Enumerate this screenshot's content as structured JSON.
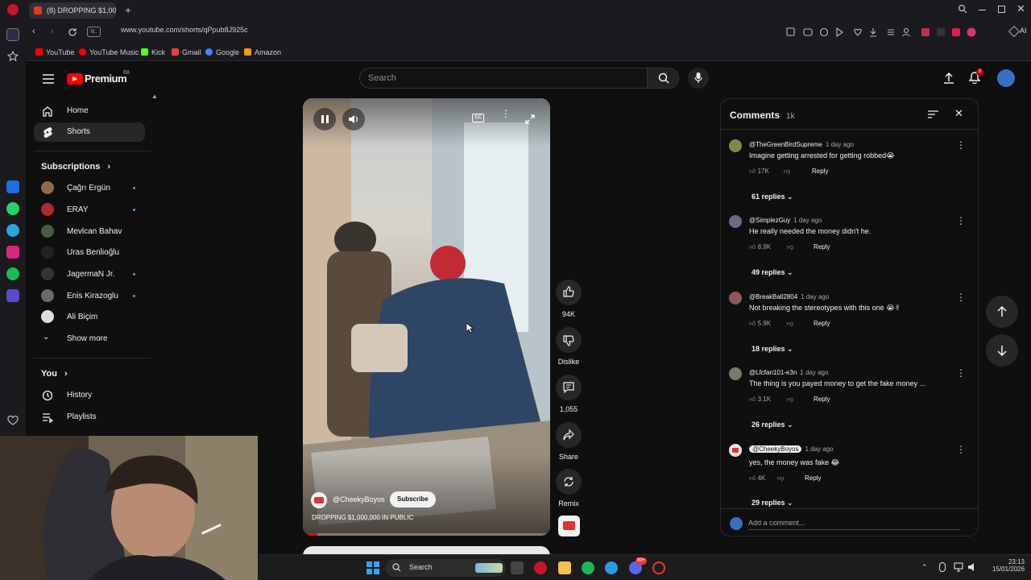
{
  "browser": {
    "tab_title": "(8) DROPPING $1,000...",
    "url": "www.youtube.com/shorts/qPpub8J925c",
    "bookmarks": [
      {
        "label": "YouTube",
        "color": "#ff0000"
      },
      {
        "label": "YouTube Music",
        "color": "#ff0000"
      },
      {
        "label": "Kick",
        "color": "#53fc18"
      },
      {
        "label": "Gmail",
        "color": "#ea4335"
      },
      {
        "label": "Google",
        "color": "#4285f4"
      },
      {
        "label": "Amazon",
        "color": "#ff9900"
      }
    ],
    "ai_label": "AI"
  },
  "youtube": {
    "logo_text": "Premium",
    "logo_badge": "68",
    "search_placeholder": "Search",
    "notifications_count": "8",
    "nav": [
      {
        "label": "Home",
        "icon": "home-icon"
      },
      {
        "label": "Shorts",
        "icon": "shorts-icon"
      }
    ],
    "subscriptions_title": "Subscriptions",
    "subscriptions": [
      {
        "name": "Çağrı Ergün",
        "dot": true
      },
      {
        "name": "ERAY",
        "dot": true
      },
      {
        "name": "Mevlcan Bahav",
        "dot": false
      },
      {
        "name": "Uras Benlioğlu",
        "dot": false
      },
      {
        "name": "JagermaN Jr.",
        "dot": true
      },
      {
        "name": "Enis Kirazoglu",
        "dot": true
      },
      {
        "name": "Ali Biçim",
        "dot": false
      }
    ],
    "show_more": "Show more",
    "you_title": "You",
    "you_items": [
      {
        "label": "History",
        "icon": "history-icon"
      },
      {
        "label": "Playlists",
        "icon": "playlists-icon"
      }
    ]
  },
  "short": {
    "channel": "@CheekyBoyos",
    "subscribe": "Subscribe",
    "title": "DROPPING $1,000,000 IN PUBLIC",
    "likes": "94K",
    "dislike": "Dislike",
    "comments_count": "1,055",
    "share": "Share",
    "remix": "Remix"
  },
  "comments_panel": {
    "title": "Comments",
    "count": "1k",
    "add_placeholder": "Add a comment...",
    "reply_label": "Reply",
    "items": [
      {
        "user": "@TheGreenBirdSupreme",
        "time": "1 day ago",
        "text": "Imagine getting arrested for getting robbed😭",
        "likes": "17K",
        "replies": "61 replies",
        "avatar": "#7a8a4a",
        "owner": false
      },
      {
        "user": "@SimplezGuy",
        "time": "1 day ago",
        "text": "He really needed the money didn't he.",
        "likes": "8.9K",
        "replies": "49 replies",
        "avatar": "#6a6a8a",
        "owner": false
      },
      {
        "user": "@BreakBall2804",
        "time": "1 day ago",
        "text": "Not breaking the stereotypes with this one 😭✌",
        "likes": "5.9K",
        "replies": "18 replies",
        "avatar": "#8a5a5a",
        "owner": false
      },
      {
        "user": "@Lfcfan101-e3n",
        "time": "1 day ago",
        "text": "The thing is you payed money to get the fake money ...",
        "likes": "3.1K",
        "replies": "26 replies",
        "avatar": "#7a7a6a",
        "owner": false
      },
      {
        "user": "@CheekyBoyos",
        "time": "1 day ago",
        "text": "yes, the money was fake 😂",
        "likes": "4K",
        "replies": "29 replies",
        "avatar": "#e8e8e8",
        "owner": true
      }
    ]
  },
  "taskbar": {
    "search": "Search",
    "time": "23:13",
    "date": "15/01/2026",
    "badge": "99+"
  }
}
